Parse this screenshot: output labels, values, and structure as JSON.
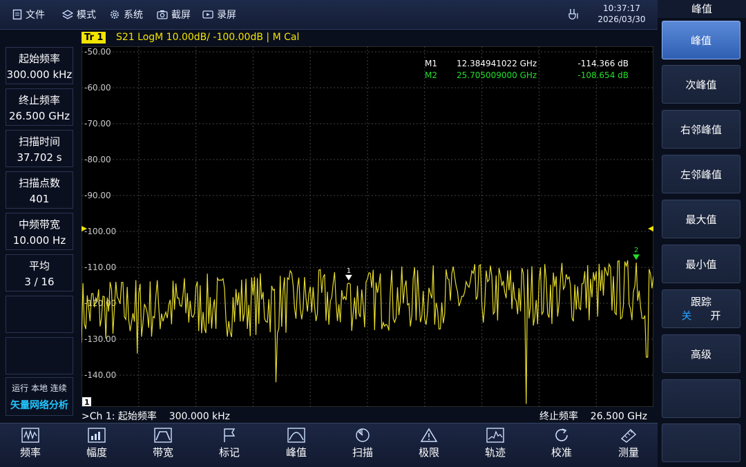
{
  "topbar": {
    "menu": [
      {
        "label": "文件",
        "icon": "document-icon"
      },
      {
        "label": "模式",
        "icon": "layers-icon"
      },
      {
        "label": "系统",
        "icon": "gear-icon"
      },
      {
        "label": "截屏",
        "icon": "camera-icon"
      },
      {
        "label": "录屏",
        "icon": "record-icon"
      }
    ],
    "time": "10:37:17",
    "date": "2026/03/30"
  },
  "right_panel": {
    "title": "峰值",
    "buttons": [
      "峰值",
      "次峰值",
      "右邻峰值",
      "左邻峰值",
      "最大值",
      "最小值"
    ],
    "tracking": {
      "label": "跟踪",
      "off": "关",
      "on": "开"
    },
    "advanced": "高级"
  },
  "left_panel": [
    {
      "label": "起始频率",
      "value": "300.000 kHz"
    },
    {
      "label": "终止频率",
      "value": "26.500 GHz"
    },
    {
      "label": "扫描时间",
      "value": "37.702 s"
    },
    {
      "label": "扫描点数",
      "value": "401"
    },
    {
      "label": "中频带宽",
      "value": "10.000 Hz"
    },
    {
      "label": "平均",
      "value": "3 / 16"
    }
  ],
  "status": {
    "line": "运行 本地 连续",
    "mode": "矢量网络分析"
  },
  "trace": {
    "badge": "Tr 1",
    "description": "S21 LogM 10.00dB/ -100.00dB | M Cal",
    "channel_marker": "1"
  },
  "markers": [
    {
      "name": "M1",
      "freq": "12.384941022 GHz",
      "value": "-114.366 dB",
      "color": "#ffffff",
      "label": "1"
    },
    {
      "name": "M2",
      "freq": "25.705009000 GHz",
      "value": "-108.654 dB",
      "color": "#22e02a",
      "label": "2"
    }
  ],
  "bottom": {
    "left": ">Ch 1: 起始频率    300.000 kHz",
    "right": "终止频率    26.500 GHz"
  },
  "toolbar": [
    {
      "label": "频率",
      "icon": "frequency-icon"
    },
    {
      "label": "幅度",
      "icon": "amplitude-icon"
    },
    {
      "label": "带宽",
      "icon": "bandwidth-icon"
    },
    {
      "label": "标记",
      "icon": "marker-flag-icon"
    },
    {
      "label": "峰值",
      "icon": "peak-icon"
    },
    {
      "label": "扫描",
      "icon": "sweep-icon"
    },
    {
      "label": "极限",
      "icon": "limit-warning-icon"
    },
    {
      "label": "轨迹",
      "icon": "trace-icon"
    },
    {
      "label": "校准",
      "icon": "calibrate-icon"
    },
    {
      "label": "测量",
      "icon": "ruler-icon"
    }
  ],
  "chart_data": {
    "type": "line",
    "title": "",
    "xlabel": "",
    "ylabel": "",
    "xlim": [
      0.0003,
      26.5
    ],
    "ylim": [
      -150,
      -50
    ],
    "yticks": [
      "-50.00",
      "-60.00",
      "-70.00",
      "-80.00",
      "-90.00",
      "-100.00",
      "-110.00",
      "-120.00",
      "-130.00",
      "-140.00"
    ],
    "reference_level": -100,
    "grid": true,
    "trace_color": "#e6dc2a",
    "series": [
      {
        "name": "S21",
        "noise_floor": -122,
        "spikes": [
          {
            "x": 2.6,
            "y": -134
          },
          {
            "x": 9.0,
            "y": -142
          },
          {
            "x": 12.38,
            "y": -114.4
          },
          {
            "x": 20.6,
            "y": -148
          },
          {
            "x": 25.7,
            "y": -108.7
          },
          {
            "x": 26.2,
            "y": -135
          }
        ]
      }
    ]
  }
}
